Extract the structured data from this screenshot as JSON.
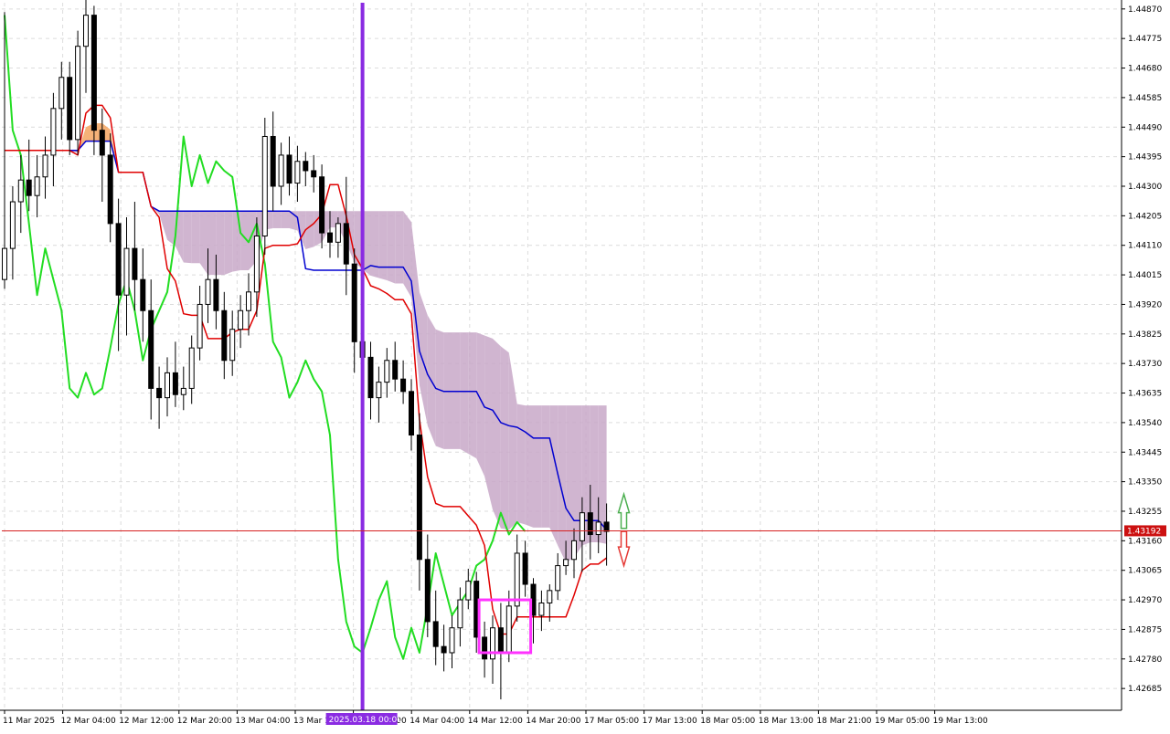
{
  "chart_data": {
    "type": "candlestick",
    "title": "",
    "price_axis": {
      "ticks": [
        "1.44870",
        "1.44775",
        "1.44680",
        "1.44585",
        "1.44490",
        "1.44395",
        "1.44300",
        "1.44205",
        "1.44110",
        "1.44015",
        "1.43920",
        "1.43825",
        "1.43730",
        "1.43635",
        "1.43540",
        "1.43445",
        "1.43350",
        "1.43255",
        "1.43160",
        "1.43065",
        "1.42970",
        "1.42875",
        "1.42780",
        "1.42685"
      ],
      "range": [
        1.42615,
        1.4489
      ],
      "current_price": "1.43192"
    },
    "time_axis": {
      "ticks": [
        "11 Mar 2025",
        "12 Mar 04:00",
        "12 Mar 12:00",
        "12 Mar 20:00",
        "13 Mar 04:00",
        "13 Mar 12:00",
        "13 Mar 20:00",
        "14 Mar 04:00",
        "14 Mar 12:00",
        "14 Mar 20:00",
        "17 Mar 05:00",
        "17 Mar 13:00",
        "18 Mar 05:00",
        "18 Mar 13:00",
        "18 Mar 21:00",
        "19 Mar 05:00",
        "19 Mar 13:00"
      ],
      "highlight_label": "2025.03.18 00:00",
      "highlight_index": 44
    },
    "candles": [
      {
        "o": 1.44,
        "h": 1.4486,
        "l": 1.4397,
        "c": 1.441
      },
      {
        "o": 1.441,
        "h": 1.443,
        "l": 1.44,
        "c": 1.4425
      },
      {
        "o": 1.4425,
        "h": 1.444,
        "l": 1.4415,
        "c": 1.4432
      },
      {
        "o": 1.4432,
        "h": 1.4445,
        "l": 1.4422,
        "c": 1.4427
      },
      {
        "o": 1.4427,
        "h": 1.444,
        "l": 1.442,
        "c": 1.4433
      },
      {
        "o": 1.4433,
        "h": 1.4446,
        "l": 1.4426,
        "c": 1.444
      },
      {
        "o": 1.444,
        "h": 1.446,
        "l": 1.443,
        "c": 1.4455
      },
      {
        "o": 1.4455,
        "h": 1.447,
        "l": 1.4445,
        "c": 1.4465
      },
      {
        "o": 1.4465,
        "h": 1.447,
        "l": 1.444,
        "c": 1.4445
      },
      {
        "o": 1.4445,
        "h": 1.448,
        "l": 1.444,
        "c": 1.4475
      },
      {
        "o": 1.4475,
        "h": 1.4492,
        "l": 1.446,
        "c": 1.4485
      },
      {
        "o": 1.4485,
        "h": 1.4488,
        "l": 1.444,
        "c": 1.4448
      },
      {
        "o": 1.4448,
        "h": 1.4455,
        "l": 1.4425,
        "c": 1.444
      },
      {
        "o": 1.444,
        "h": 1.4447,
        "l": 1.4412,
        "c": 1.4418
      },
      {
        "o": 1.4418,
        "h": 1.4426,
        "l": 1.4377,
        "c": 1.4395
      },
      {
        "o": 1.4395,
        "h": 1.442,
        "l": 1.4382,
        "c": 1.441
      },
      {
        "o": 1.441,
        "h": 1.4425,
        "l": 1.439,
        "c": 1.44
      },
      {
        "o": 1.44,
        "h": 1.441,
        "l": 1.438,
        "c": 1.439
      },
      {
        "o": 1.439,
        "h": 1.44,
        "l": 1.4355,
        "c": 1.4365
      },
      {
        "o": 1.4365,
        "h": 1.4372,
        "l": 1.4352,
        "c": 1.4362
      },
      {
        "o": 1.4362,
        "h": 1.4375,
        "l": 1.4356,
        "c": 1.437
      },
      {
        "o": 1.437,
        "h": 1.438,
        "l": 1.4359,
        "c": 1.4363
      },
      {
        "o": 1.4363,
        "h": 1.4372,
        "l": 1.4358,
        "c": 1.4365
      },
      {
        "o": 1.4365,
        "h": 1.4382,
        "l": 1.436,
        "c": 1.4378
      },
      {
        "o": 1.4378,
        "h": 1.4398,
        "l": 1.4374,
        "c": 1.4392
      },
      {
        "o": 1.4392,
        "h": 1.441,
        "l": 1.4386,
        "c": 1.44
      },
      {
        "o": 1.44,
        "h": 1.4408,
        "l": 1.4384,
        "c": 1.439
      },
      {
        "o": 1.439,
        "h": 1.4396,
        "l": 1.4368,
        "c": 1.4374
      },
      {
        "o": 1.4374,
        "h": 1.439,
        "l": 1.4369,
        "c": 1.4384
      },
      {
        "o": 1.4384,
        "h": 1.4395,
        "l": 1.4378,
        "c": 1.439
      },
      {
        "o": 1.439,
        "h": 1.4402,
        "l": 1.4382,
        "c": 1.4396
      },
      {
        "o": 1.4396,
        "h": 1.442,
        "l": 1.4388,
        "c": 1.4414
      },
      {
        "o": 1.4414,
        "h": 1.4452,
        "l": 1.4408,
        "c": 1.4446
      },
      {
        "o": 1.4446,
        "h": 1.4454,
        "l": 1.4422,
        "c": 1.443
      },
      {
        "o": 1.443,
        "h": 1.4444,
        "l": 1.4424,
        "c": 1.444
      },
      {
        "o": 1.444,
        "h": 1.4446,
        "l": 1.4427,
        "c": 1.4431
      },
      {
        "o": 1.4431,
        "h": 1.4443,
        "l": 1.4425,
        "c": 1.4438
      },
      {
        "o": 1.4438,
        "h": 1.4441,
        "l": 1.443,
        "c": 1.4435
      },
      {
        "o": 1.4435,
        "h": 1.444,
        "l": 1.4428,
        "c": 1.4433
      },
      {
        "o": 1.4433,
        "h": 1.4437,
        "l": 1.441,
        "c": 1.4415
      },
      {
        "o": 1.4415,
        "h": 1.4422,
        "l": 1.4407,
        "c": 1.4412
      },
      {
        "o": 1.4412,
        "h": 1.442,
        "l": 1.4407,
        "c": 1.4418
      },
      {
        "o": 1.4418,
        "h": 1.4433,
        "l": 1.4395,
        "c": 1.4405
      },
      {
        "o": 1.4405,
        "h": 1.441,
        "l": 1.437,
        "c": 1.438
      },
      {
        "o": 1.438,
        "h": 1.4388,
        "l": 1.4364,
        "c": 1.4375
      },
      {
        "o": 1.4375,
        "h": 1.438,
        "l": 1.4355,
        "c": 1.4362
      },
      {
        "o": 1.4362,
        "h": 1.4372,
        "l": 1.4354,
        "c": 1.4367
      },
      {
        "o": 1.4367,
        "h": 1.4378,
        "l": 1.4362,
        "c": 1.4374
      },
      {
        "o": 1.4374,
        "h": 1.438,
        "l": 1.4364,
        "c": 1.4368
      },
      {
        "o": 1.4368,
        "h": 1.4374,
        "l": 1.436,
        "c": 1.4364
      },
      {
        "o": 1.4364,
        "h": 1.4368,
        "l": 1.4345,
        "c": 1.435
      },
      {
        "o": 1.435,
        "h": 1.4357,
        "l": 1.43,
        "c": 1.431
      },
      {
        "o": 1.431,
        "h": 1.4318,
        "l": 1.4285,
        "c": 1.429
      },
      {
        "o": 1.429,
        "h": 1.43,
        "l": 1.4276,
        "c": 1.4282
      },
      {
        "o": 1.4282,
        "h": 1.4289,
        "l": 1.4274,
        "c": 1.428
      },
      {
        "o": 1.428,
        "h": 1.4292,
        "l": 1.4275,
        "c": 1.4288
      },
      {
        "o": 1.4288,
        "h": 1.4301,
        "l": 1.4282,
        "c": 1.4297
      },
      {
        "o": 1.4297,
        "h": 1.4307,
        "l": 1.4294,
        "c": 1.4303
      },
      {
        "o": 1.4303,
        "h": 1.4306,
        "l": 1.428,
        "c": 1.4285
      },
      {
        "o": 1.4285,
        "h": 1.429,
        "l": 1.4272,
        "c": 1.4278
      },
      {
        "o": 1.4278,
        "h": 1.4292,
        "l": 1.427,
        "c": 1.4288
      },
      {
        "o": 1.4288,
        "h": 1.4296,
        "l": 1.4265,
        "c": 1.428
      },
      {
        "o": 1.428,
        "h": 1.43,
        "l": 1.4277,
        "c": 1.4295
      },
      {
        "o": 1.4295,
        "h": 1.4318,
        "l": 1.429,
        "c": 1.4312
      },
      {
        "o": 1.4312,
        "h": 1.4316,
        "l": 1.4298,
        "c": 1.4302
      },
      {
        "o": 1.4302,
        "h": 1.4304,
        "l": 1.4283,
        "c": 1.4292
      },
      {
        "o": 1.4292,
        "h": 1.43,
        "l": 1.4287,
        "c": 1.4296
      },
      {
        "o": 1.4296,
        "h": 1.4302,
        "l": 1.429,
        "c": 1.43
      },
      {
        "o": 1.43,
        "h": 1.4312,
        "l": 1.4297,
        "c": 1.4308
      },
      {
        "o": 1.4308,
        "h": 1.4316,
        "l": 1.4305,
        "c": 1.431
      },
      {
        "o": 1.431,
        "h": 1.432,
        "l": 1.4304,
        "c": 1.4316
      },
      {
        "o": 1.4316,
        "h": 1.433,
        "l": 1.4306,
        "c": 1.4325
      },
      {
        "o": 1.4325,
        "h": 1.4334,
        "l": 1.431,
        "c": 1.4318
      },
      {
        "o": 1.4318,
        "h": 1.433,
        "l": 1.4312,
        "c": 1.4322
      },
      {
        "o": 1.4322,
        "h": 1.4328,
        "l": 1.4308,
        "c": 1.4319
      }
    ],
    "series": [],
    "annotations": {
      "arrow_up_color": "#4caf50",
      "arrow_down_color": "#e53935"
    },
    "colors": {
      "tenkan": "#e00000",
      "kijun": "#0000d0",
      "chikou": "#22dd22",
      "cloud_bull": "#f4a460",
      "cloud_bear": "#c8a8c8",
      "vline": "#8a2be2",
      "hline": "#d62020",
      "highlight_box": "#ff33ff",
      "price_tag_bg": "#cc1010"
    },
    "grid": true
  }
}
